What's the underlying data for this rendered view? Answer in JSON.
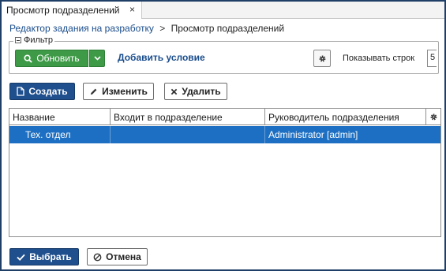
{
  "tab": {
    "title": "Просмотр подразделений",
    "close": "×"
  },
  "breadcrumb": {
    "parent": "Редактор задания на разработку",
    "separator": ">",
    "current": "Просмотр подразделений"
  },
  "filter": {
    "legend": "Фильтр",
    "refresh_label": "Обновить",
    "add_condition": "Добавить условие",
    "show_rows_label": "Показывать строк",
    "rows_value": "5"
  },
  "actions": {
    "create": "Создать",
    "edit": "Изменить",
    "delete": "Удалить"
  },
  "grid": {
    "columns": [
      "Название",
      "Входит в подразделение",
      "Руководитель подразделения"
    ],
    "rows": [
      {
        "name": "Тех. отдел",
        "parent": "",
        "head": "Administrator [admin]",
        "selected": true
      }
    ]
  },
  "footer": {
    "select": "Выбрать",
    "cancel": "Отмена"
  },
  "colors": {
    "primary": "#1f4f8d",
    "success": "#3e9a47",
    "selection": "#1c6fc2",
    "link": "#1a4d8c"
  }
}
